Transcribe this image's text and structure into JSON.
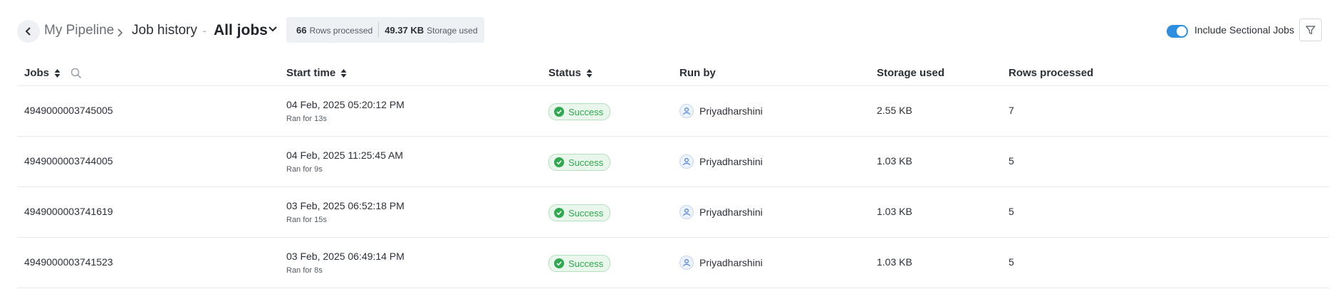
{
  "breadcrumb": {
    "pipeline": "My Pipeline",
    "history": "Job history",
    "separator": "-",
    "view": "All jobs"
  },
  "stats": {
    "rows_value": "66",
    "rows_label": "Rows processed",
    "storage_value": "49.37 KB",
    "storage_label": "Storage used"
  },
  "toggle": {
    "label": "Include Sectional Jobs",
    "on": true
  },
  "columns": {
    "jobs": "Jobs",
    "start_time": "Start time",
    "status": "Status",
    "run_by": "Run by",
    "storage": "Storage used",
    "rows": "Rows processed"
  },
  "rows": [
    {
      "job": "4949000003745005",
      "start": "04 Feb, 2025 05:20:12 PM",
      "duration": "Ran for 13s",
      "status": "Success",
      "run_by": "Priyadharshini",
      "storage": "2.55 KB",
      "rows": "7"
    },
    {
      "job": "4949000003744005",
      "start": "04 Feb, 2025 11:25:45 AM",
      "duration": "Ran for 9s",
      "status": "Success",
      "run_by": "Priyadharshini",
      "storage": "1.03 KB",
      "rows": "5"
    },
    {
      "job": "4949000003741619",
      "start": "03 Feb, 2025 06:52:18 PM",
      "duration": "Ran for 15s",
      "status": "Success",
      "run_by": "Priyadharshini",
      "storage": "1.03 KB",
      "rows": "5"
    },
    {
      "job": "4949000003741523",
      "start": "03 Feb, 2025 06:49:14 PM",
      "duration": "Ran for 8s",
      "status": "Success",
      "run_by": "Priyadharshini",
      "storage": "1.03 KB",
      "rows": "5"
    }
  ],
  "colors": {
    "accent": "#2e8ee0",
    "success": "#2fa84f",
    "success_bg": "#e8f6eb"
  },
  "icons": [
    "chevron-left-icon",
    "chevron-right-icon",
    "chevron-down-icon",
    "sort-icon",
    "search-icon",
    "filter-icon",
    "check-circle-icon",
    "user-avatar-icon"
  ]
}
